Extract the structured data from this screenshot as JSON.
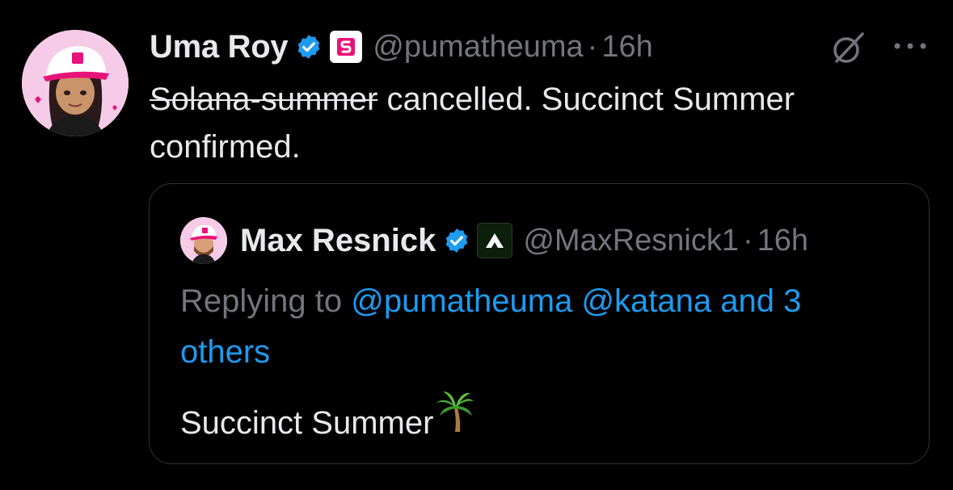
{
  "tweet": {
    "author_name": "Uma Roy",
    "author_handle": "@pumatheuma",
    "separator": "·",
    "time": "16h",
    "text_struck": "Solana-summer",
    "text_rest": " cancelled. Succinct Summer confirmed."
  },
  "quote": {
    "author_name": "Max Resnick",
    "author_handle": "@MaxResnick1",
    "separator": "·",
    "time": "16h",
    "replying_prefix": "Replying to ",
    "replying_links": "@pumatheuma @katana and 3 others",
    "text": "Succinct Summer",
    "emoji_icon": "palm-tree-icon"
  },
  "icons": {
    "verified": "verified-badge-icon",
    "affiliation_uma": "succinct-logo-icon",
    "affiliation_max": "katana-logo-icon",
    "grok": "grok-icon",
    "more": "more-options-icon"
  },
  "colors": {
    "background": "#000000",
    "primary_text": "#e7e9ea",
    "secondary_text": "#71767b",
    "link": "#1d9bf0",
    "verified": "#1d9bf0",
    "brand_pink": "#e8137a"
  }
}
